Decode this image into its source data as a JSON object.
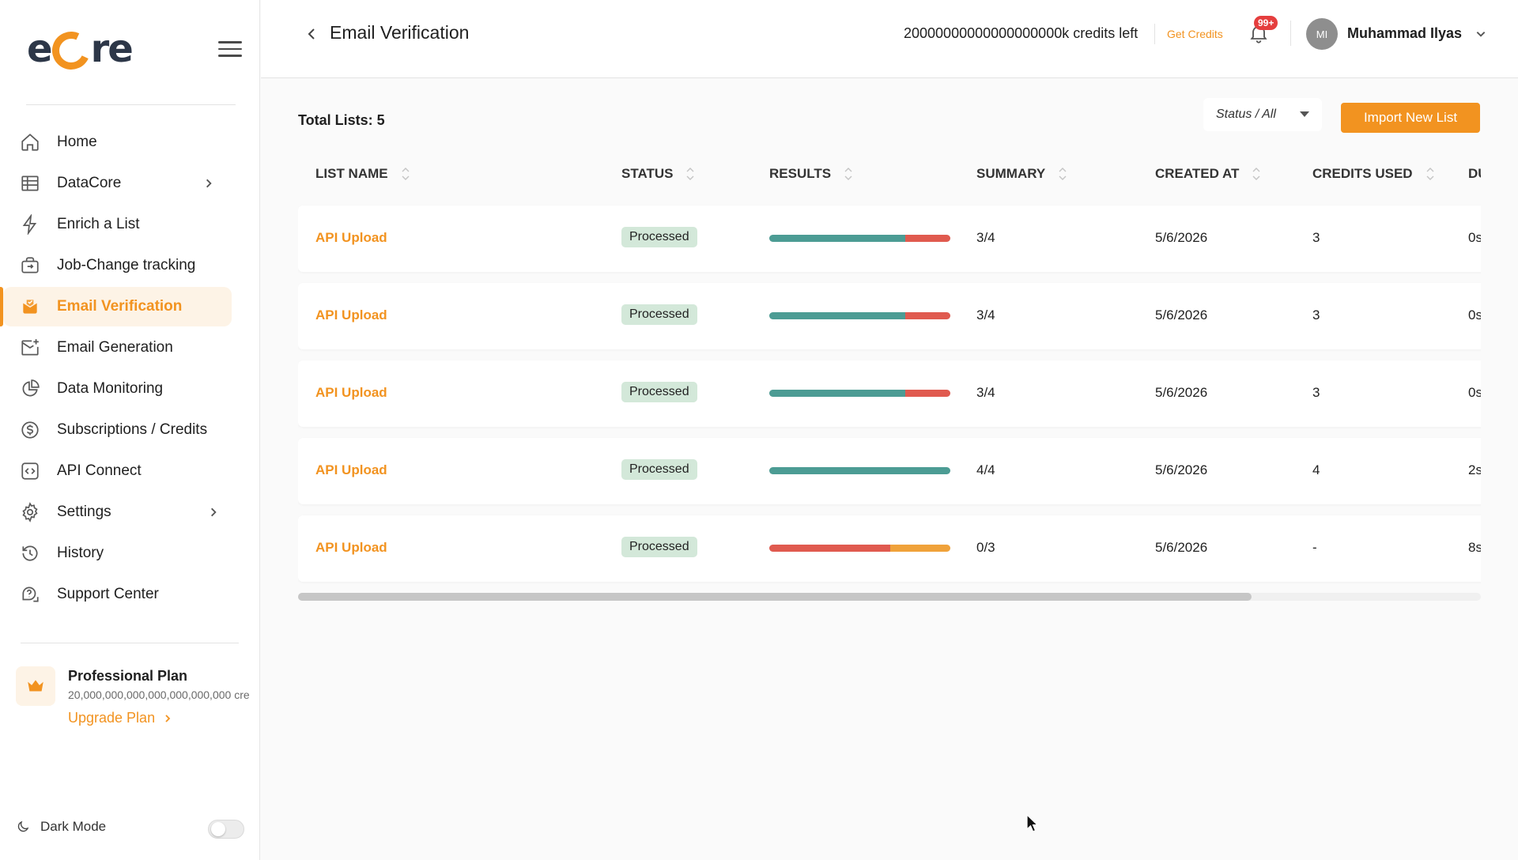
{
  "brand": {
    "logo_text_before": "e",
    "logo_text_after": "re",
    "accent": "#f29320"
  },
  "sidebar": {
    "items": [
      {
        "label": "Home",
        "icon": "home-icon"
      },
      {
        "label": "DataCore",
        "icon": "table-icon"
      },
      {
        "label": "Enrich a List",
        "icon": "bolt-icon"
      },
      {
        "label": "Job-Change tracking",
        "icon": "briefcase-icon"
      },
      {
        "label": "Email Verification",
        "icon": "mail-check-icon"
      },
      {
        "label": "Email Generation",
        "icon": "mail-plus-icon"
      },
      {
        "label": "Data Monitoring",
        "icon": "pie-chart-icon"
      },
      {
        "label": "Subscriptions / Credits",
        "icon": "dollar-icon"
      },
      {
        "label": "API Connect",
        "icon": "code-icon"
      },
      {
        "label": "Settings",
        "icon": "gear-icon"
      },
      {
        "label": "History",
        "icon": "history-icon"
      },
      {
        "label": "Support Center",
        "icon": "help-icon"
      }
    ],
    "plan": {
      "title": "Professional Plan",
      "credits": "20,000,000,000,000,000,000,000 cre",
      "upgrade_label": "Upgrade Plan"
    },
    "dark_mode_label": "Dark Mode"
  },
  "header": {
    "title": "Email Verification",
    "credits_left": "20000000000000000000k credits left",
    "get_credits": "Get Credits",
    "notifications_badge": "99+",
    "avatar_initials": "MI",
    "user_name": "Muhammad Ilyas"
  },
  "main": {
    "total_lists": "Total Lists: 5",
    "status_filter": "Status / All",
    "import_button": "Import New List",
    "columns": [
      "LIST NAME",
      "STATUS",
      "RESULTS",
      "SUMMARY",
      "CREATED AT",
      "CREDITS USED",
      "DU"
    ],
    "rows": [
      {
        "name": "API Upload",
        "status": "Processed",
        "summary": "3/4",
        "created": "5/6/2026",
        "credits": "3",
        "duration": "0s",
        "results": [
          {
            "pct": 75,
            "color": "#4c9c94"
          },
          {
            "pct": 25,
            "color": "#e05a4f"
          }
        ]
      },
      {
        "name": "API Upload",
        "status": "Processed",
        "summary": "3/4",
        "created": "5/6/2026",
        "credits": "3",
        "duration": "0s",
        "results": [
          {
            "pct": 75,
            "color": "#4c9c94"
          },
          {
            "pct": 25,
            "color": "#e05a4f"
          }
        ]
      },
      {
        "name": "API Upload",
        "status": "Processed",
        "summary": "3/4",
        "created": "5/6/2026",
        "credits": "3",
        "duration": "0s",
        "results": [
          {
            "pct": 75,
            "color": "#4c9c94"
          },
          {
            "pct": 25,
            "color": "#e05a4f"
          }
        ]
      },
      {
        "name": "API Upload",
        "status": "Processed",
        "summary": "4/4",
        "created": "5/6/2026",
        "credits": "4",
        "duration": "2s",
        "results": [
          {
            "pct": 100,
            "color": "#4c9c94"
          }
        ]
      },
      {
        "name": "API Upload",
        "status": "Processed",
        "summary": "0/3",
        "created": "5/6/2026",
        "credits": "-",
        "duration": "8s",
        "results": [
          {
            "pct": 67,
            "color": "#e05a4f"
          },
          {
            "pct": 33,
            "color": "#f0a23a"
          }
        ]
      }
    ]
  }
}
